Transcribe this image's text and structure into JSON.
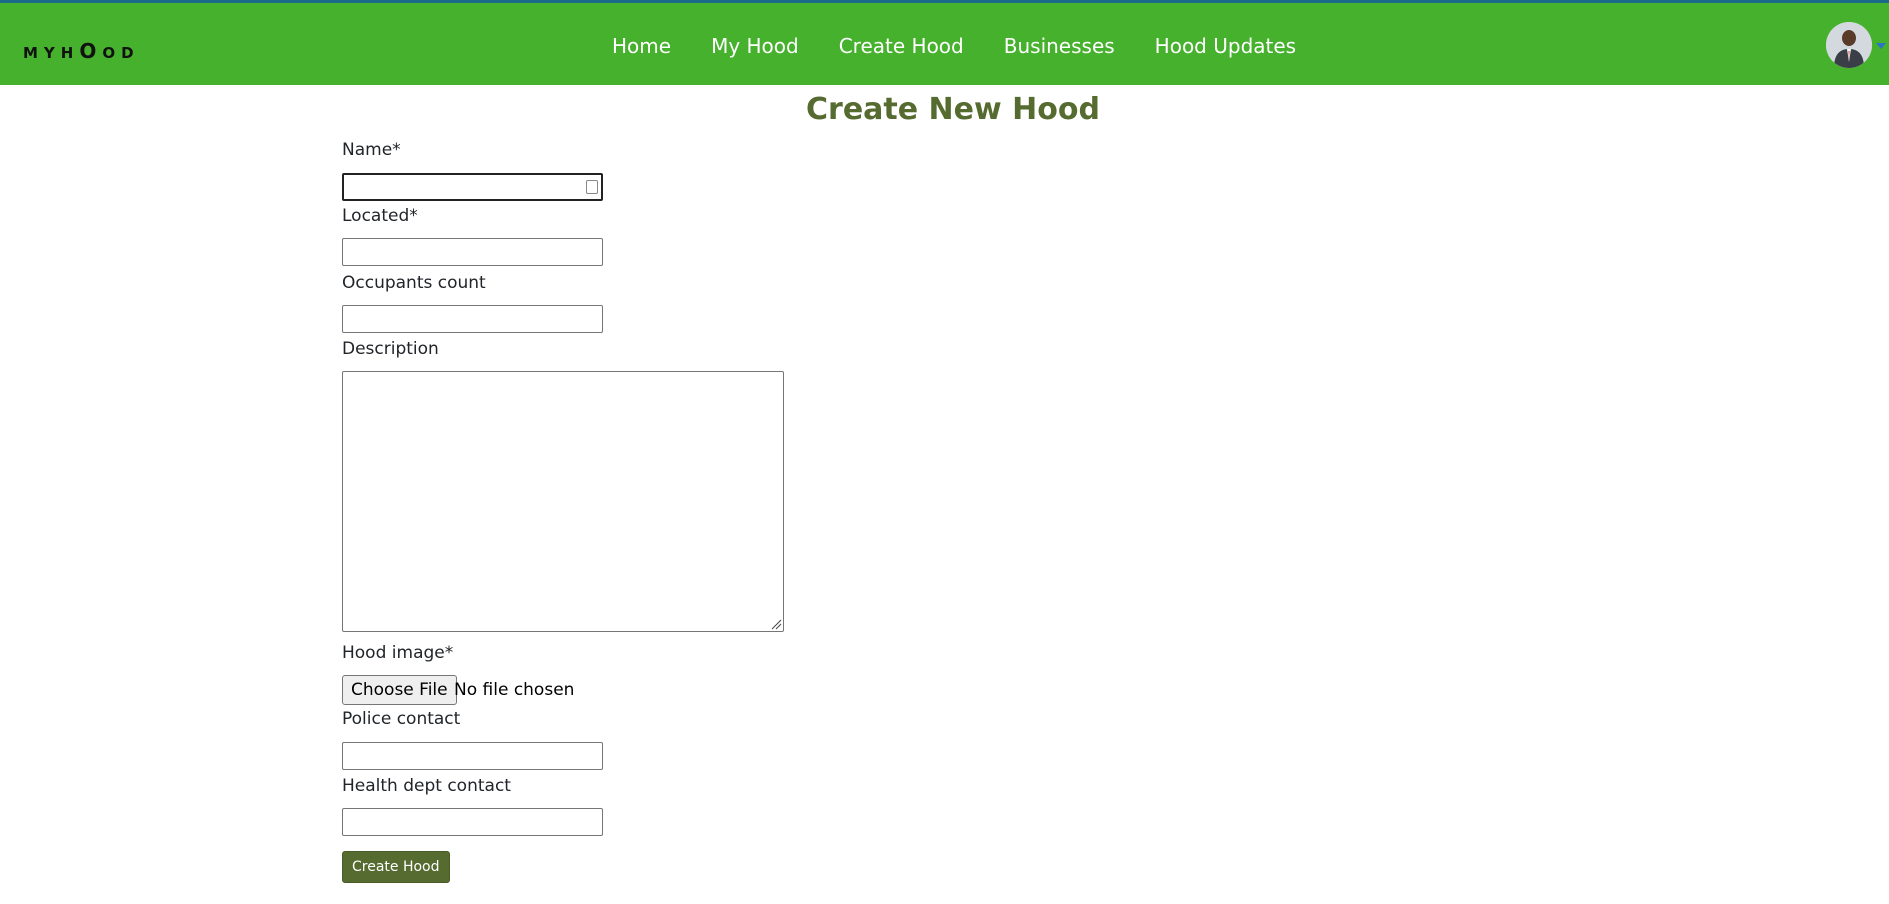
{
  "navbar": {
    "brand": {
      "my": "MY",
      "h": "H",
      "o1": "O",
      "o2": "O",
      "d": "D"
    },
    "links": [
      "Home",
      "My Hood",
      "Create Hood",
      "Businesses",
      "Hood Updates"
    ],
    "bg_color": "#46b12c"
  },
  "page": {
    "title": "Create New Hood",
    "title_color": "#556b2f"
  },
  "form": {
    "name_label": "Name*",
    "name_value": "",
    "located_label": "Located*",
    "located_value": "",
    "occupants_label": "Occupants count",
    "occupants_value": "",
    "description_label": "Description",
    "description_value": "",
    "image_label": "Hood image*",
    "choose_file_label": "Choose File",
    "file_status": "No file chosen",
    "police_label": "Police contact",
    "police_value": "",
    "health_label": "Health dept contact",
    "health_value": "",
    "submit_label": "Create Hood"
  },
  "icons": {
    "avatar": "user-avatar",
    "caret": "chevron-down-icon",
    "autofill": "contact-card-icon"
  }
}
